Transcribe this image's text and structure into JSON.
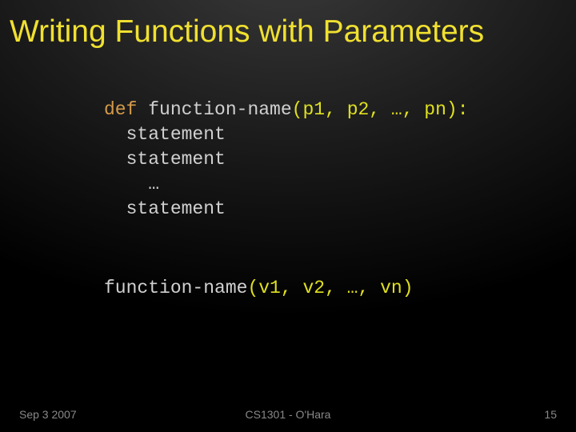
{
  "title": "Writing Functions with Parameters",
  "code": {
    "kw_def": "def",
    "fn_name": "function-name",
    "params_open": "(",
    "params_list": "p1, p2, …, pn",
    "params_close": ")",
    "colon": ":",
    "stmt1": "statement",
    "stmt2": "statement",
    "ellipsis": "…",
    "stmt3": "statement"
  },
  "call": {
    "fn_name": "function-name",
    "open": "(",
    "args": "v1, v2, …, vn",
    "close": ")"
  },
  "footer": {
    "date": "Sep 3 2007",
    "course": "CS1301 - O'Hara",
    "page": "15"
  }
}
